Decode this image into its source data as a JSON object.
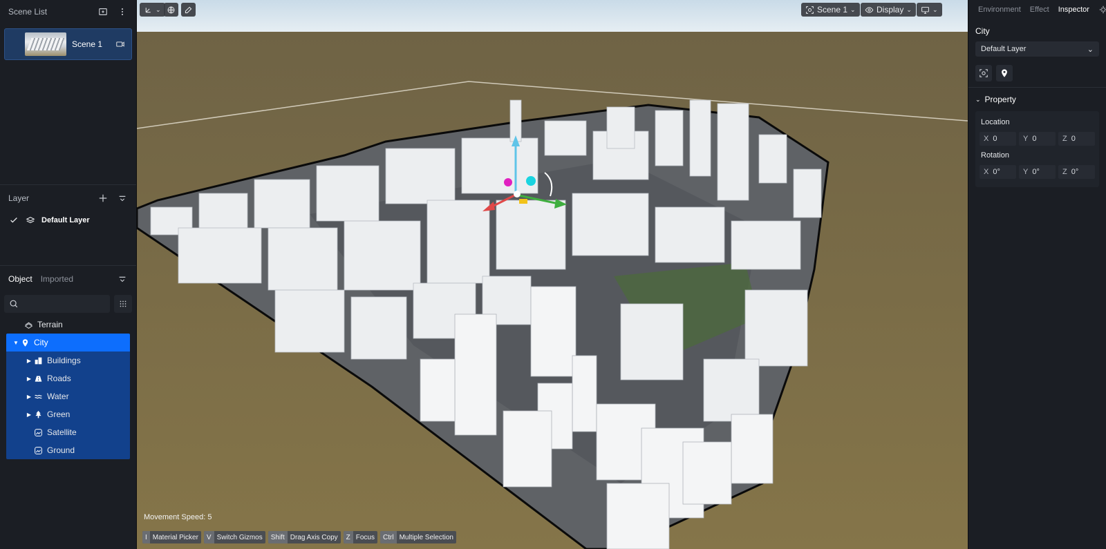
{
  "left_panel": {
    "scene_list": {
      "title": "Scene List",
      "scenes": [
        {
          "name": "Scene 1"
        }
      ]
    },
    "layer": {
      "title": "Layer",
      "items": [
        {
          "name": "Default Layer",
          "checked": true
        }
      ]
    },
    "objects": {
      "tabs": [
        {
          "label": "Object",
          "active": true
        },
        {
          "label": "Imported",
          "active": false
        }
      ],
      "search_placeholder": "",
      "tree": [
        {
          "label": "Terrain",
          "icon": "terrain-icon"
        },
        {
          "label": "City",
          "icon": "location-pin-icon",
          "selected": true
        },
        {
          "label": "Buildings",
          "icon": "buildings-icon"
        },
        {
          "label": "Roads",
          "icon": "road-icon"
        },
        {
          "label": "Water",
          "icon": "water-icon"
        },
        {
          "label": "Green",
          "icon": "tree-icon"
        },
        {
          "label": "Satellite",
          "icon": "satellite-icon"
        },
        {
          "label": "Ground",
          "icon": "ground-icon"
        }
      ]
    }
  },
  "viewport": {
    "scene_select": "Scene 1",
    "display_label": "Display",
    "movement_speed": "Movement Speed: 5",
    "shortcuts": [
      {
        "key": "I",
        "label": "Material Picker"
      },
      {
        "key": "V",
        "label": "Switch Gizmos"
      },
      {
        "key": "Shift",
        "label": "Drag Axis Copy"
      },
      {
        "key": "Z",
        "label": "Focus"
      },
      {
        "key": "Ctrl",
        "label": "Multiple Selection"
      }
    ]
  },
  "right_panel": {
    "tabs": [
      {
        "label": "Environment"
      },
      {
        "label": "Effect"
      },
      {
        "label": "Inspector",
        "active": true
      }
    ],
    "object_name": "City",
    "layer_select": "Default Layer",
    "property_title": "Property",
    "location": {
      "label": "Location",
      "x": "0",
      "y": "0",
      "z": "0"
    },
    "rotation": {
      "label": "Rotation",
      "x": "0°",
      "y": "0°",
      "z": "0°"
    },
    "axis_labels": {
      "x": "X",
      "y": "Y",
      "z": "Z"
    }
  },
  "colors": {
    "accent": "#0d6efd",
    "selection_child": "#12418c",
    "ground": "#7a6b45"
  }
}
